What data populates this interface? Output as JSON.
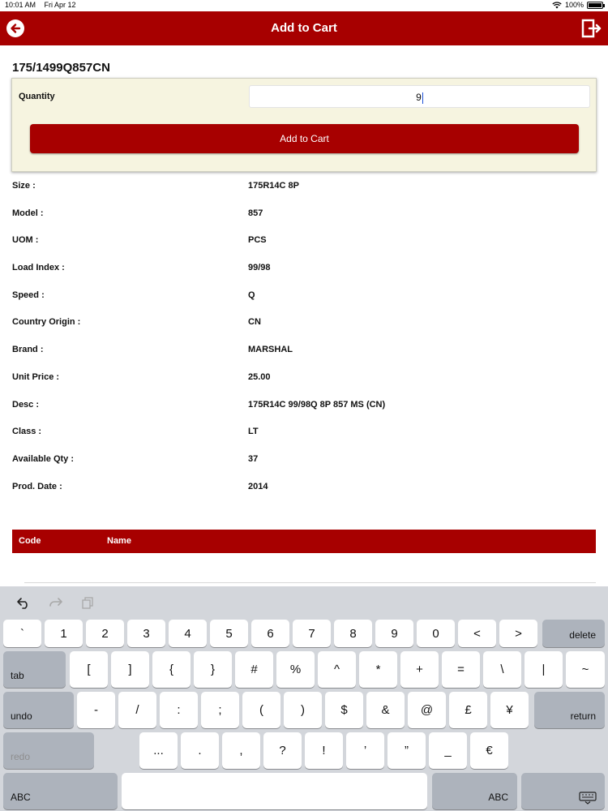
{
  "status": {
    "time": "10:01 AM",
    "date": "Fri Apr 12",
    "battery": "100%",
    "battery_level": 1.0
  },
  "nav": {
    "title": "Add to Cart",
    "back_icon": "arrow-left-circle-icon",
    "logout_icon": "logout-door-icon"
  },
  "product": {
    "code": "175/1499Q857CN"
  },
  "quantity": {
    "label": "Quantity",
    "value": "9",
    "button": "Add to Cart"
  },
  "details": [
    {
      "label": "Size :",
      "value": "175R14C 8P"
    },
    {
      "label": "Model :",
      "value": "857"
    },
    {
      "label": "UOM :",
      "value": "PCS"
    },
    {
      "label": "Load Index :",
      "value": "99/98"
    },
    {
      "label": "Speed :",
      "value": "Q"
    },
    {
      "label": "Country Origin :",
      "value": "CN"
    },
    {
      "label": "Brand :",
      "value": "MARSHAL"
    },
    {
      "label": "Unit Price :",
      "value": "25.00"
    },
    {
      "label": "Desc :",
      "value": "175R14C  99/98Q 8P 857 MS (CN)"
    },
    {
      "label": "Class :",
      "value": "LT"
    },
    {
      "label": "Available Qty :",
      "value": "37"
    },
    {
      "label": "Prod. Date :",
      "value": "2014"
    }
  ],
  "table": {
    "columns": [
      "Code",
      "Name"
    ]
  },
  "keyboard": {
    "tools": [
      "undo-icon",
      "redo-icon",
      "paste-icon"
    ],
    "row1": [
      "`",
      "1",
      "2",
      "3",
      "4",
      "5",
      "6",
      "7",
      "8",
      "9",
      "0",
      "<",
      ">"
    ],
    "row1_end": "delete",
    "row2_start": "tab",
    "row2": [
      "[",
      "]",
      "{",
      "}",
      "#",
      "%",
      "^",
      "*",
      "+",
      "=",
      "\\",
      "|",
      "~"
    ],
    "row3_start": "undo",
    "row3": [
      "-",
      "/",
      ":",
      ";",
      "(",
      ")",
      "$",
      "&",
      "@",
      "£",
      "¥"
    ],
    "row3_end": "return",
    "row4_start": "redo",
    "row4": [
      "...",
      ".",
      ",",
      "?",
      "!",
      "’",
      "”",
      "_",
      "€"
    ],
    "row5_left": "ABC",
    "row5_right": "ABC",
    "dismiss_icon": "keyboard-dismiss-icon"
  }
}
